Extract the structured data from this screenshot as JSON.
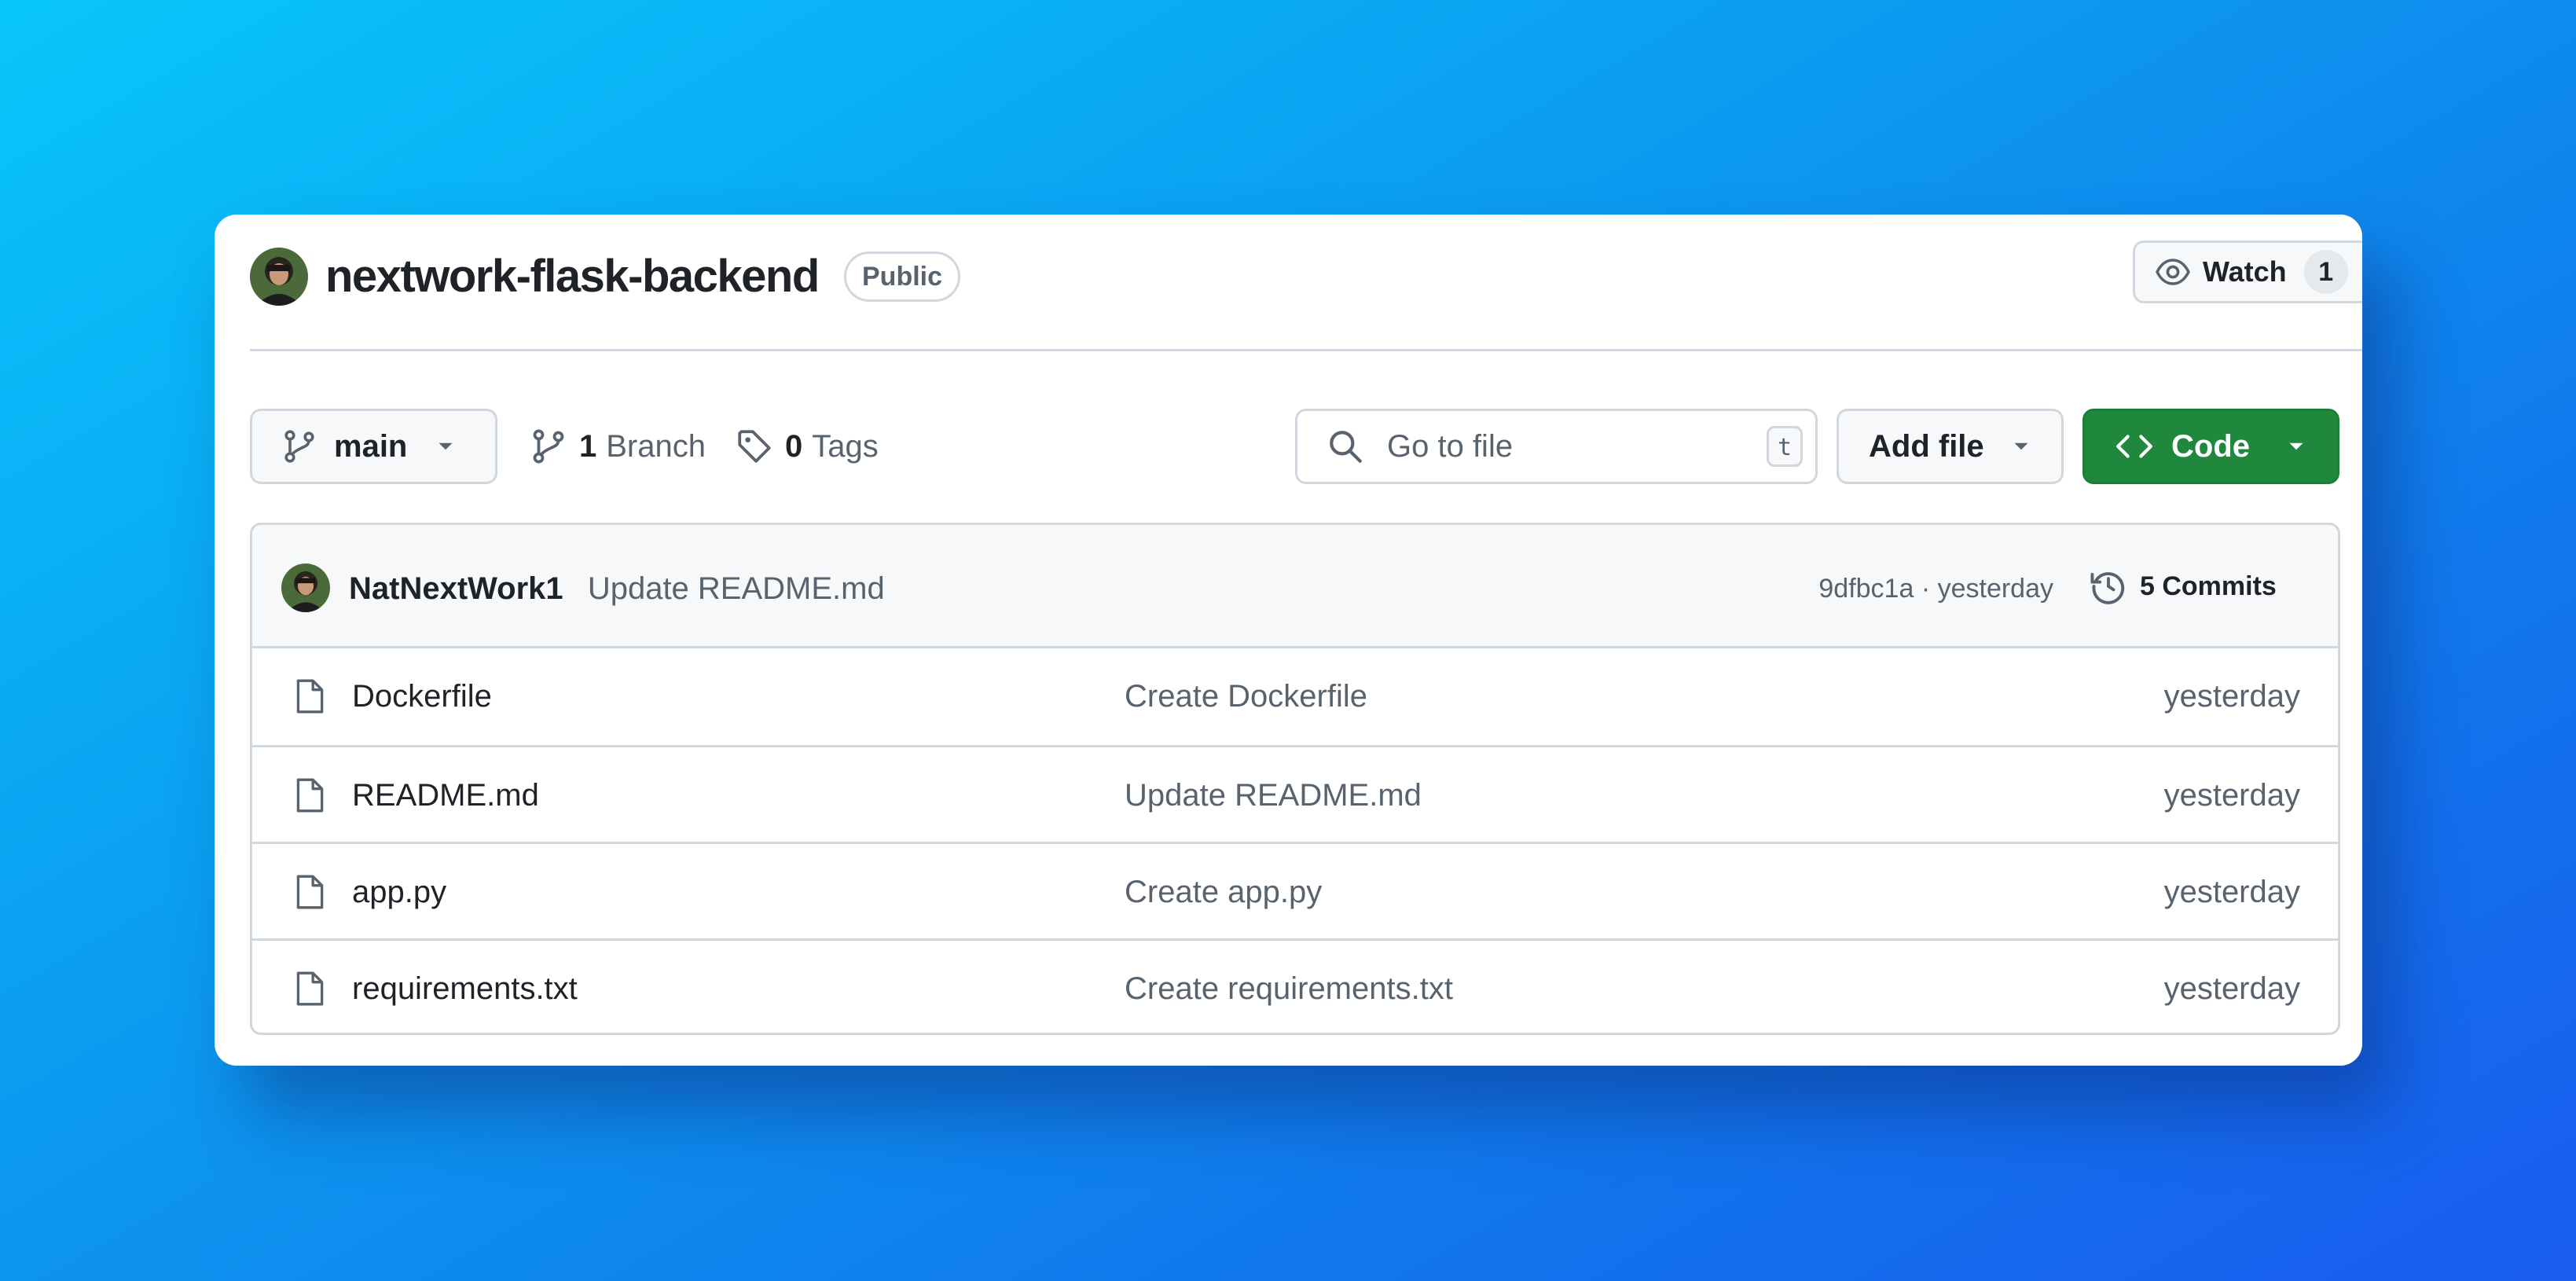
{
  "repo": {
    "name": "nextwork-flask-backend",
    "visibility": "Public",
    "avatar_icon": "user-avatar"
  },
  "watch": {
    "label": "Watch",
    "count": "1",
    "icon": "eye-icon"
  },
  "toolbar": {
    "branch_name": "main",
    "branch_count": "1",
    "branch_label": "Branch",
    "tag_count": "0",
    "tag_label": "Tags",
    "search_placeholder": "Go to file",
    "search_shortcut": "t",
    "add_file_label": "Add file",
    "code_label": "Code",
    "code_color": "#1f883d"
  },
  "latest_commit": {
    "author": "NatNextWork1",
    "message": "Update README.md",
    "hash_time": "9dfbc1a · yesterday",
    "commits_label": "5 Commits"
  },
  "files": [
    {
      "name": "Dockerfile",
      "message": "Create Dockerfile",
      "time": "yesterday"
    },
    {
      "name": "README.md",
      "message": "Update README.md",
      "time": "yesterday"
    },
    {
      "name": "app.py",
      "message": "Create app.py",
      "time": "yesterday"
    },
    {
      "name": "requirements.txt",
      "message": "Create requirements.txt",
      "time": "yesterday"
    }
  ]
}
